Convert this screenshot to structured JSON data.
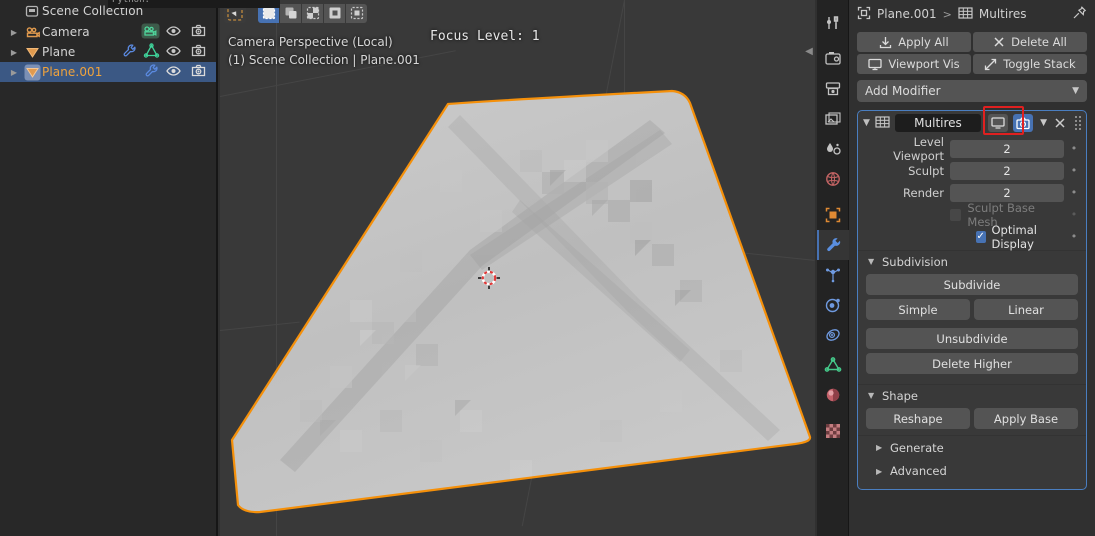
{
  "outliner": {
    "collection": {
      "label": "Scene Collection",
      "icon": "collection-icon"
    },
    "items": [
      {
        "label": "Camera",
        "icon": "camera-object-icon",
        "data_icons": [
          "camera-data-icon"
        ],
        "selected": false,
        "visible": true,
        "renderable": true
      },
      {
        "label": "Plane",
        "icon": "mesh-object-icon",
        "data_icons": [
          "modifier-wrench-icon",
          "mesh-data-icon"
        ],
        "selected": false,
        "visible": true,
        "renderable": true
      },
      {
        "label": "Plane.001",
        "icon": "mesh-object-icon",
        "data_icons": [
          "modifier-wrench-icon"
        ],
        "selected": true,
        "visible": true,
        "renderable": true
      }
    ]
  },
  "tooltip": {
    "text": "Python: bpy.ops.object.modifier_..."
  },
  "viewport": {
    "select_modes": [
      {
        "name": "set",
        "active": true
      },
      {
        "name": "extend",
        "active": false
      },
      {
        "name": "subtract",
        "active": false
      },
      {
        "name": "invert",
        "active": false
      },
      {
        "name": "intersect",
        "active": false
      }
    ],
    "view_name": "Camera Perspective (Local)",
    "scene_info": "(1) Scene Collection | Plane.001",
    "focus_label": "Focus Level: 1",
    "object_outline_color": "#f5900a",
    "background_color": "#393939",
    "mesh_color": "#c3c3c3"
  },
  "property_tabs": [
    {
      "name": "tool",
      "color": "#c8c8c8",
      "active": false
    },
    {
      "name": "render",
      "color": "#c8c8c8",
      "active": false
    },
    {
      "name": "output",
      "color": "#c8c8c8",
      "active": false
    },
    {
      "name": "view-layer",
      "color": "#c8c8c8",
      "active": false
    },
    {
      "name": "scene",
      "color": "#c8c8c8",
      "active": false
    },
    {
      "name": "world",
      "color": "#c46464",
      "active": false
    },
    {
      "name": "object",
      "color": "#e08a33",
      "active": false
    },
    {
      "name": "modifiers",
      "color": "#5a8fe0",
      "active": true
    },
    {
      "name": "particles",
      "color": "#6f9ae0",
      "active": false
    },
    {
      "name": "physics",
      "color": "#6f9ae0",
      "active": false
    },
    {
      "name": "object-constraints",
      "color": "#6f9ae0",
      "active": false
    },
    {
      "name": "object-data",
      "color": "#45c98a",
      "active": false
    },
    {
      "name": "material",
      "color": "#c4616a",
      "active": false
    },
    {
      "name": "texture",
      "color": "#c47d80",
      "active": false
    }
  ],
  "properties": {
    "breadcrumb": {
      "object_icon": "object-icon",
      "object": "Plane.001",
      "separator": ">",
      "modifier_icon": "multires-grid-icon",
      "modifier": "Multires",
      "pin_icon": "pin-icon"
    },
    "stack_buttons": [
      {
        "label": "Apply All",
        "icon": "download-icon"
      },
      {
        "label": "Delete All",
        "icon": "x-icon"
      },
      {
        "label": "Viewport Vis",
        "icon": "monitor-icon"
      },
      {
        "label": "Toggle Stack",
        "icon": "expand-icon"
      }
    ],
    "add_modifier": {
      "label": "Add Modifier",
      "chevron": "chevron-down-icon"
    },
    "modifier": {
      "expand_icon": "chevron-down-icon",
      "type_icon": "multires-grid-icon",
      "name": "Multires",
      "display_toggles": [
        {
          "name": "realtime-display-toggle",
          "icon": "monitor-icon",
          "active": false
        },
        {
          "name": "render-display-toggle",
          "icon": "camera-icon",
          "active": true
        }
      ],
      "highlight_box_color": "#e02020",
      "dropdown_icon": "chevron-down-icon",
      "close_icon": "x-icon",
      "drag_icon": "drag-dots-icon",
      "fields": [
        {
          "label": "Level Viewport",
          "value": "2"
        },
        {
          "label": "Sculpt",
          "value": "2"
        },
        {
          "label": "Render",
          "value": "2"
        }
      ],
      "checkboxes": [
        {
          "label": "Sculpt Base Mesh",
          "checked": false,
          "disabled": true
        },
        {
          "label": "Optimal Display",
          "checked": true,
          "disabled": false
        }
      ],
      "sections": [
        {
          "title": "Subdivision",
          "expanded": true,
          "wide_buttons_top": [
            "Subdivide"
          ],
          "half_buttons": [
            "Simple",
            "Linear"
          ],
          "wide_buttons_bottom": [
            "Unsubdivide",
            "Delete Higher"
          ]
        },
        {
          "title": "Shape",
          "expanded": true,
          "half_buttons": [
            "Reshape",
            "Apply Base"
          ]
        }
      ],
      "collapsed_sections": [
        {
          "title": "Generate"
        },
        {
          "title": "Advanced"
        }
      ]
    }
  }
}
